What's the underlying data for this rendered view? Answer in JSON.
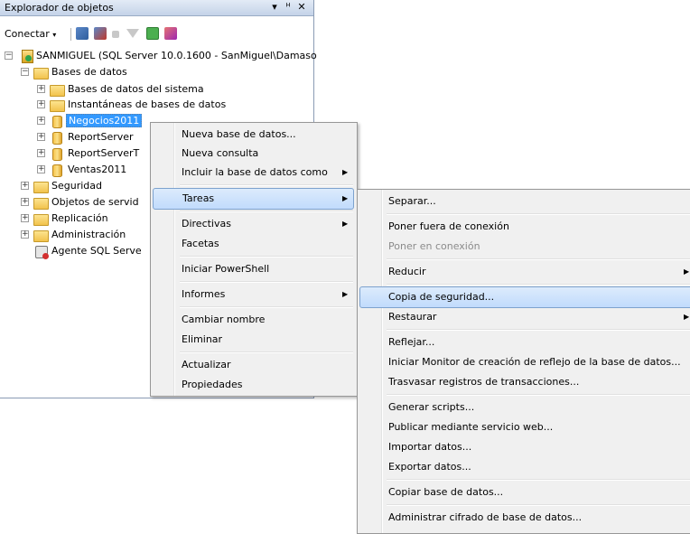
{
  "explorer": {
    "title": "Explorador de objetos",
    "pin_glyph": "▾",
    "autohide_glyph": "ᵸ",
    "close_glyph": "✕",
    "connect_label": "Conectar",
    "connect_arrow": "▾"
  },
  "tree": {
    "server": "SANMIGUEL (SQL Server 10.0.1600 - SanMiguel\\Damaso",
    "databases": "Bases de datos",
    "system_dbs": "Bases de datos del sistema",
    "snapshots": "Instantáneas de bases de datos",
    "db1": "Negocios2011",
    "db2": "ReportServer",
    "db3": "ReportServerT",
    "db4": "Ventas2011",
    "security": "Seguridad",
    "server_objects": "Objetos de servid",
    "replication": "Replicación",
    "administration": "Administración",
    "agent": "Agente SQL Serve",
    "expand_plus": "+",
    "expand_minus": "−"
  },
  "context_menu": {
    "new_db": "Nueva base de datos...",
    "new_query": "Nueva consulta",
    "script_db_as": "Incluir la base de datos como",
    "tasks": "Tareas",
    "policies": "Directivas",
    "facets": "Facetas",
    "powershell": "Iniciar PowerShell",
    "reports": "Informes",
    "rename": "Cambiar nombre",
    "delete": "Eliminar",
    "refresh": "Actualizar",
    "properties": "Propiedades",
    "arrow": "▶"
  },
  "tasks_menu": {
    "detach": "Separar...",
    "take_offline": "Poner fuera de conexión",
    "bring_online": "Poner en conexión",
    "shrink": "Reducir",
    "backup": "Copia de seguridad...",
    "restore": "Restaurar",
    "mirror": "Reflejar...",
    "mirror_monitor": "Iniciar Monitor de creación de reflejo de la base de datos...",
    "ship_logs": "Trasvasar registros de transacciones...",
    "gen_scripts": "Generar scripts...",
    "publish_web": "Publicar mediante servicio web...",
    "import": "Importar datos...",
    "export": "Exportar datos...",
    "copy_db": "Copiar base de datos...",
    "encryption": "Administrar cifrado de base de datos...",
    "arrow": "▶"
  },
  "colors": {
    "selection": "#3399ff",
    "highlight_border": "#7da2ce",
    "menu_bg": "#f0f0f0"
  }
}
